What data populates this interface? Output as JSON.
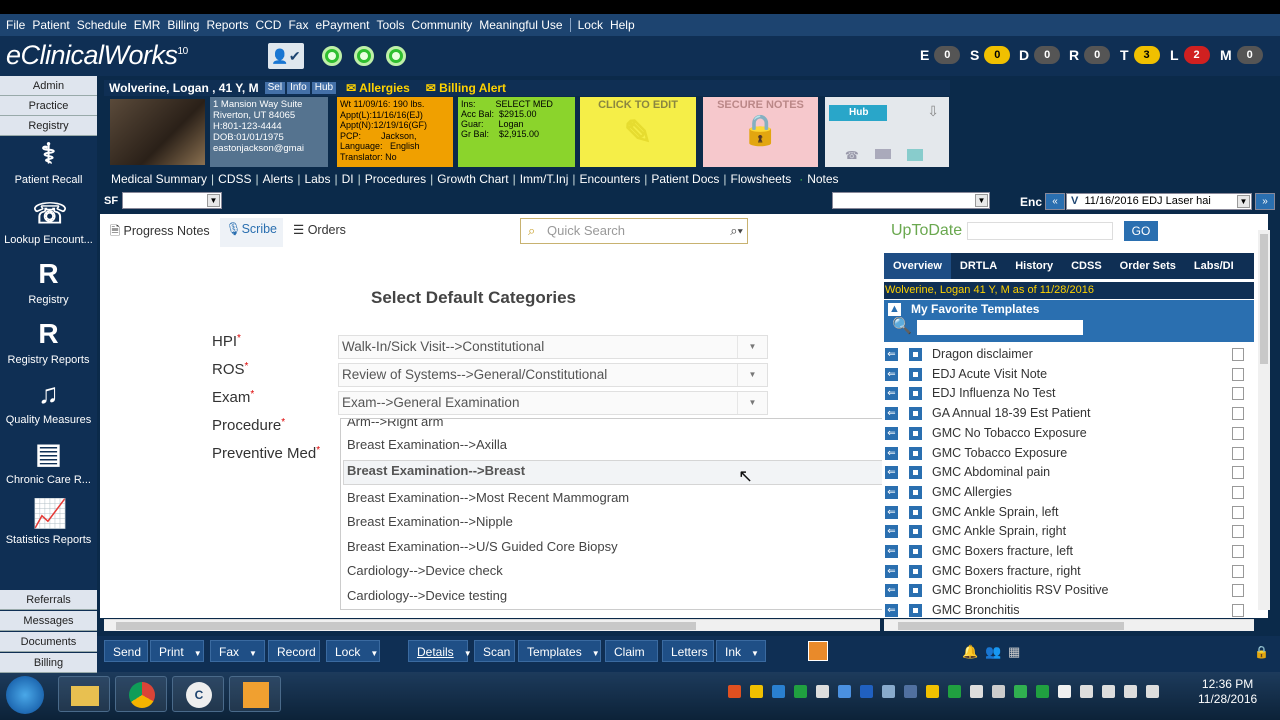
{
  "menu": [
    "File",
    "Patient",
    "Schedule",
    "EMR",
    "Billing",
    "Reports",
    "CCD",
    "Fax",
    "ePayment",
    "Tools",
    "Community",
    "Meaningful Use",
    "Lock",
    "Help"
  ],
  "brand": {
    "name": "eClinicalWorks",
    "version": "10"
  },
  "counters": [
    {
      "letter": "E",
      "value": "0",
      "color": "#555555"
    },
    {
      "letter": "S",
      "value": "0",
      "color": "#f0c000"
    },
    {
      "letter": "D",
      "value": "0",
      "color": "#555555"
    },
    {
      "letter": "R",
      "value": "0",
      "color": "#555555"
    },
    {
      "letter": "T",
      "value": "3",
      "color": "#f0c000"
    },
    {
      "letter": "L",
      "value": "2",
      "color": "#d02020"
    },
    {
      "letter": "M",
      "value": "0",
      "color": "#555555"
    }
  ],
  "sidebar": {
    "top": [
      "Admin",
      "Practice",
      "Registry"
    ],
    "items": [
      "Patient Recall",
      "Lookup Encount...",
      "Registry",
      "Registry Reports",
      "Quality Measures",
      "Chronic Care R...",
      "Statistics Reports"
    ],
    "bottom": [
      "Referrals",
      "Messages",
      "Documents",
      "Billing"
    ]
  },
  "patient": {
    "name": "Wolverine, Logan , 41 Y, M",
    "tags": [
      "Sel",
      "Info",
      "Hub"
    ],
    "allergies": "Allergies",
    "billing_alert": "Billing Alert",
    "address": [
      "1 Mansion Way Suite",
      "Riverton, UT 84065",
      "H:801-123-4444",
      "DOB:01/01/1975",
      "eastonjackson@gmai"
    ],
    "appt": [
      "Wt 11/09/16: 190 lbs.",
      "Appt(L):11/16/16(EJ)",
      "Appt(N):12/19/16(GF)",
      "PCP:        Jackson,",
      "Language:   English",
      "Translator: No"
    ],
    "ins": [
      "Ins:        SELECT MED",
      "Acc Bal:  $2915.00",
      "Guar:      Logan",
      "Gr Bal:    $2,915.00"
    ],
    "click_to_edit": "CLICK TO EDIT",
    "secure_notes": "SECURE NOTES",
    "hub": "Hub"
  },
  "tabs": [
    "Medical Summary",
    "CDSS",
    "Alerts",
    "Labs",
    "DI",
    "Procedures",
    "Growth Chart",
    "Imm/T.Inj",
    "Encounters",
    "Patient Docs",
    "Flowsheets",
    "Notes"
  ],
  "sf_label": "SF",
  "enc": {
    "label": "Enc",
    "value": "11/16/2016 EDJ Laser hai",
    "prefix": "V"
  },
  "subtabs": [
    "Progress Notes",
    "Scribe",
    "Orders"
  ],
  "quick_search": "Quick Search",
  "section_title": "Select Default Categories",
  "fields": [
    {
      "label": "HPI",
      "value": "Walk-In/Sick Visit-->Constitutional"
    },
    {
      "label": "ROS",
      "value": "Review of Systems-->General/Constitutional"
    },
    {
      "label": "Exam",
      "value": "Exam-->General Examination"
    },
    {
      "label": "Procedure",
      "value": ""
    },
    {
      "label": "Preventive Med",
      "value": ""
    }
  ],
  "dropdown_options": [
    "Arm-->Right arm",
    "Breast Examination-->Axilla",
    "Breast Examination-->Breast",
    "Breast Examination-->Most Recent Mammogram",
    "Breast Examination-->Nipple",
    "Breast Examination-->U/S Guided Core Biopsy",
    "Cardiology-->Device check",
    "Cardiology-->Device testing"
  ],
  "dropdown_selected": "Breast Examination-->Breast",
  "right_panel": {
    "uptodate": "UpToDate",
    "go": "GO",
    "tabs": [
      "Overview",
      "DRTLA",
      "History",
      "CDSS",
      "Order Sets",
      "Labs/DI"
    ],
    "patient_line": "Wolverine, Logan 41 Y, M as of 11/28/2016",
    "fav_title": "My Favorite Templates",
    "templates": [
      "Dragon disclaimer",
      "EDJ Acute Visit Note",
      "EDJ Influenza No Test",
      "GA Annual 18-39 Est Patient",
      "GMC No Tobacco Exposure",
      "GMC Tobacco Exposure",
      "GMC Abdominal pain",
      "GMC Allergies",
      "GMC Ankle Sprain, left",
      "GMC Ankle Sprain, right",
      "GMC Boxers fracture, left",
      "GMC Boxers fracture, right",
      "GMC Bronchiolitis RSV Positive",
      "GMC Bronchitis"
    ]
  },
  "toolbar": [
    "Send",
    "Print",
    "Fax",
    "Record",
    "Lock",
    "Details",
    "Scan",
    "Templates",
    "Claim",
    "Letters",
    "Ink"
  ],
  "clock": {
    "time": "12:36 PM",
    "date": "11/28/2016"
  }
}
